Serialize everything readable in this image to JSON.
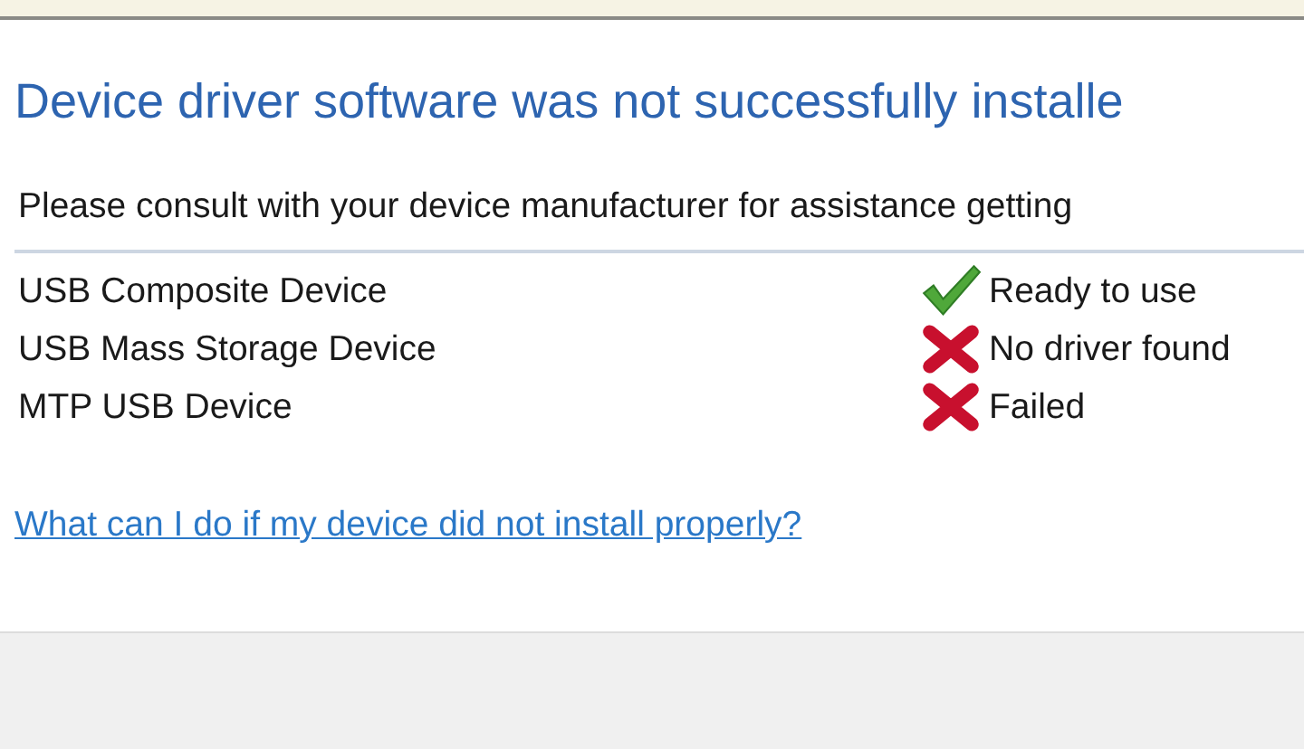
{
  "heading": "Device driver software was not successfully installe",
  "message": "Please consult with your device manufacturer for assistance getting",
  "devices": [
    {
      "name": "USB Composite Device",
      "kind": "ok",
      "status": "Ready to use"
    },
    {
      "name": "USB Mass Storage Device",
      "kind": "error",
      "status": "No driver found"
    },
    {
      "name": "MTP USB Device",
      "kind": "error",
      "status": "Failed"
    }
  ],
  "help_link": "What can I do if my device did not install properly?"
}
